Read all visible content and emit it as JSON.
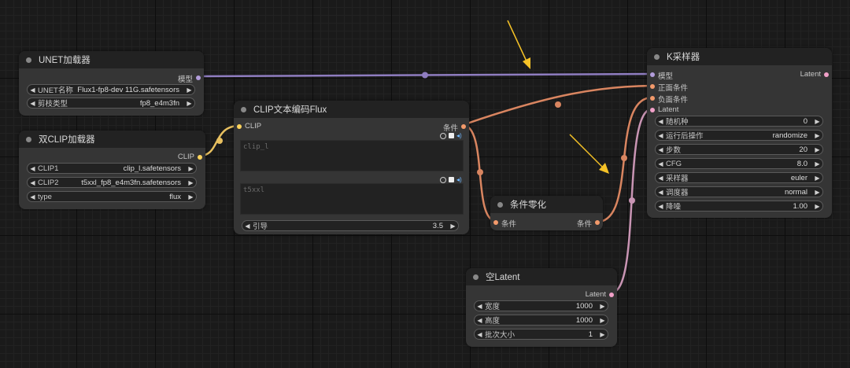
{
  "colors": {
    "model_link": "#8f7dc0",
    "clip_link": "#e8c060",
    "cond_link": "#d98560",
    "latent_link": "#c995b4",
    "annotation_arrow": "#f5c227"
  },
  "nodes": {
    "unet_loader": {
      "title": "UNET加载器",
      "output_model": "模型",
      "widgets": [
        {
          "label": "UNET名称",
          "value": "Flux1-fp8-dev 11G.safetensors"
        },
        {
          "label": "剪枝类型",
          "value": "fp8_e4m3fn"
        }
      ]
    },
    "dual_clip_loader": {
      "title": "双CLIP加载器",
      "output_clip": "CLIP",
      "widgets": [
        {
          "label": "CLIP1",
          "value": "clip_l.safetensors"
        },
        {
          "label": "CLIP2",
          "value": "t5xxl_fp8_e4m3fn.safetensors"
        },
        {
          "label": "type",
          "value": "flux"
        }
      ]
    },
    "clip_text_encode": {
      "title": "CLIP文本编码Flux",
      "input_clip": "CLIP",
      "output_cond": "条件",
      "clip_l_placeholder": "clip_l",
      "t5xxl_placeholder": "t5xxl",
      "guidance_label": "引导",
      "guidance_value": "3.5"
    },
    "cond_zero": {
      "title": "条件零化",
      "input_cond": "条件",
      "output_cond": "条件"
    },
    "empty_latent": {
      "title": "空Latent",
      "output_latent": "Latent",
      "widgets": [
        {
          "label": "宽度",
          "value": "1000"
        },
        {
          "label": "高度",
          "value": "1000"
        },
        {
          "label": "批次大小",
          "value": "1"
        }
      ]
    },
    "ksampler": {
      "title": "K采样器",
      "inputs": [
        "模型",
        "正面条件",
        "负面条件",
        "Latent"
      ],
      "output_latent": "Latent",
      "widgets": [
        {
          "label": "随机种",
          "value": "0"
        },
        {
          "label": "运行后操作",
          "value": "randomize"
        },
        {
          "label": "步数",
          "value": "20"
        },
        {
          "label": "CFG",
          "value": "8.0"
        },
        {
          "label": "采样器",
          "value": "euler"
        },
        {
          "label": "调度器",
          "value": "normal"
        },
        {
          "label": "降噪",
          "value": "1.00"
        }
      ]
    }
  }
}
